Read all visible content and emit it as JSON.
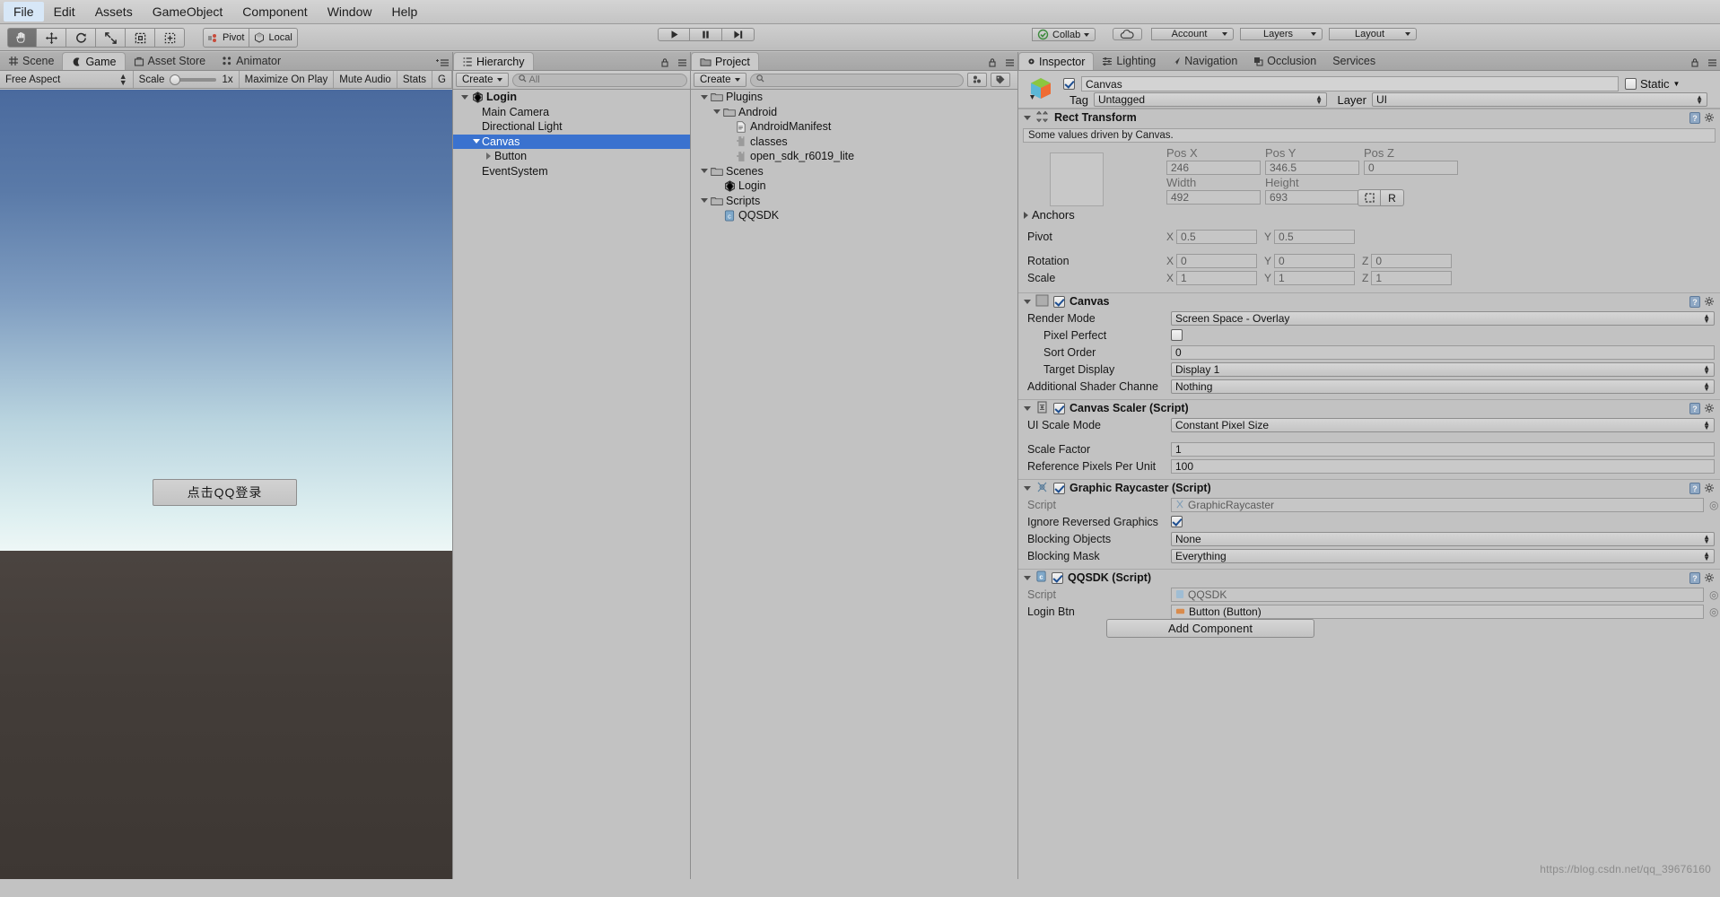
{
  "menubar": {
    "items": [
      "File",
      "Edit",
      "Assets",
      "GameObject",
      "Component",
      "Window",
      "Help"
    ]
  },
  "toolbar": {
    "tools": [
      {
        "name": "hand-tool",
        "selected": true
      },
      {
        "name": "move-tool",
        "selected": false
      },
      {
        "name": "rotate-tool",
        "selected": false
      },
      {
        "name": "scale-tool",
        "selected": false
      },
      {
        "name": "rect-tool",
        "selected": false
      },
      {
        "name": "transform-tool",
        "selected": false
      }
    ],
    "pivot_label": "Pivot",
    "local_label": "Local",
    "play_label": "▶",
    "pause_label": "❙❙",
    "step_label": "▶❙",
    "collab_label": "Collab",
    "cloud_label": "cloud-icon",
    "account_label": "Account",
    "layers_label": "Layers",
    "layout_label": "Layout"
  },
  "sceneview": {
    "tabs": [
      {
        "label": "Scene",
        "icon": "grid-icon",
        "active": false
      },
      {
        "label": "Game",
        "icon": "gamepad-icon",
        "active": true
      },
      {
        "label": "Asset Store",
        "icon": "store-icon",
        "active": false
      },
      {
        "label": "Animator",
        "icon": "animator-icon",
        "active": false
      }
    ],
    "gamebar": {
      "aspect": "Free Aspect",
      "scale_label": "Scale",
      "scale_value": "1x",
      "maximize_label": "Maximize On Play",
      "mute_label": "Mute Audio",
      "stats_label": "Stats",
      "gizmos_label": "G"
    },
    "button_label": "点击QQ登录"
  },
  "hierarchy": {
    "tab_label": "Hierarchy",
    "create_label": "Create",
    "search_placeholder": "All",
    "items": [
      {
        "label": "Login",
        "depth": 0,
        "icon": "unity-scene-icon",
        "arrow": "down",
        "bold": true,
        "selected": false
      },
      {
        "label": "Main Camera",
        "depth": 1,
        "icon": "none",
        "arrow": "none",
        "bold": false,
        "selected": false
      },
      {
        "label": "Directional Light",
        "depth": 1,
        "icon": "none",
        "arrow": "none",
        "bold": false,
        "selected": false
      },
      {
        "label": "Canvas",
        "depth": 1,
        "icon": "none",
        "arrow": "down",
        "bold": false,
        "selected": true
      },
      {
        "label": "Button",
        "depth": 2,
        "icon": "none",
        "arrow": "right",
        "bold": false,
        "selected": false
      },
      {
        "label": "EventSystem",
        "depth": 1,
        "icon": "none",
        "arrow": "none",
        "bold": false,
        "selected": false
      }
    ]
  },
  "project": {
    "tab_label": "Project",
    "create_label": "Create",
    "search_placeholder": "",
    "items": [
      {
        "label": "Plugins",
        "depth": 0,
        "icon": "folder-icon",
        "arrow": "down"
      },
      {
        "label": "Android",
        "depth": 1,
        "icon": "folder-icon",
        "arrow": "down"
      },
      {
        "label": "AndroidManifest",
        "depth": 2,
        "icon": "xml-file-icon",
        "arrow": "none"
      },
      {
        "label": "classes",
        "depth": 2,
        "icon": "plugin-icon",
        "arrow": "none"
      },
      {
        "label": "open_sdk_r6019_lite",
        "depth": 2,
        "icon": "plugin-icon",
        "arrow": "none"
      },
      {
        "label": "Scenes",
        "depth": 0,
        "icon": "folder-icon",
        "arrow": "down"
      },
      {
        "label": "Login",
        "depth": 1,
        "icon": "unity-scene-icon",
        "arrow": "none"
      },
      {
        "label": "Scripts",
        "depth": 0,
        "icon": "folder-icon",
        "arrow": "down"
      },
      {
        "label": "QQSDK",
        "depth": 1,
        "icon": "cs-script-icon",
        "arrow": "none"
      }
    ]
  },
  "inspector": {
    "tabs": [
      {
        "label": "Inspector",
        "icon": "inspector-icon",
        "active": true
      },
      {
        "label": "Lighting",
        "icon": "lighting-icon",
        "active": false
      },
      {
        "label": "Navigation",
        "icon": "navigation-icon",
        "active": false
      },
      {
        "label": "Occlusion",
        "icon": "occlusion-icon",
        "active": false
      },
      {
        "label": "Services",
        "icon": "services-icon",
        "active": false
      }
    ],
    "object_name": "Canvas",
    "object_enabled": true,
    "static_label": "Static",
    "static_checked": false,
    "tag_label": "Tag",
    "tag_value": "Untagged",
    "layer_label": "Layer",
    "layer_value": "UI",
    "rect_transform": {
      "title": "Rect Transform",
      "driven_note": "Some values driven by Canvas.",
      "pos_x_label": "Pos X",
      "pos_x": "246",
      "pos_y_label": "Pos Y",
      "pos_y": "346.5",
      "pos_z_label": "Pos Z",
      "pos_z": "0",
      "width_label": "Width",
      "width": "492",
      "height_label": "Height",
      "height": "693",
      "blueprint_label": "⬚",
      "raw_label": "R",
      "anchors_label": "Anchors",
      "pivot_label": "Pivot",
      "pivot_x": "0.5",
      "pivot_y": "0.5",
      "rotation_label": "Rotation",
      "rot_x": "0",
      "rot_y": "0",
      "rot_z": "0",
      "scale_label": "Scale",
      "scale_x": "1",
      "scale_y": "1",
      "scale_z": "1"
    },
    "canvas": {
      "title": "Canvas",
      "enabled": true,
      "render_mode_label": "Render Mode",
      "render_mode_value": "Screen Space - Overlay",
      "pixel_perfect_label": "Pixel Perfect",
      "pixel_perfect_checked": false,
      "sort_order_label": "Sort Order",
      "sort_order_value": "0",
      "target_display_label": "Target Display",
      "target_display_value": "Display 1",
      "shader_channel_label": "Additional Shader Channe",
      "shader_channel_value": "Nothing"
    },
    "canvas_scaler": {
      "title": "Canvas Scaler (Script)",
      "enabled": true,
      "ui_scale_mode_label": "UI Scale Mode",
      "ui_scale_mode_value": "Constant Pixel Size",
      "scale_factor_label": "Scale Factor",
      "scale_factor_value": "1",
      "ref_ppu_label": "Reference Pixels Per Unit",
      "ref_ppu_value": "100"
    },
    "graphic_raycaster": {
      "title": "Graphic Raycaster (Script)",
      "enabled": true,
      "script_label": "Script",
      "script_value": "GraphicRaycaster",
      "ignore_reversed_label": "Ignore Reversed Graphics",
      "ignore_reversed_checked": true,
      "blocking_objects_label": "Blocking Objects",
      "blocking_objects_value": "None",
      "blocking_mask_label": "Blocking Mask",
      "blocking_mask_value": "Everything"
    },
    "qqsdk": {
      "title": "QQSDK (Script)",
      "enabled": true,
      "script_label": "Script",
      "script_value": "QQSDK",
      "login_btn_label": "Login Btn",
      "login_btn_value": "Button (Button)"
    },
    "add_component_label": "Add Component"
  },
  "watermark": "https://blog.csdn.net/qq_39676160",
  "colors": {
    "selection_blue": "#3a72cf",
    "panel_gray": "#c2c2c2",
    "toolbar_gray": "#c6c6c6",
    "accent_checkbox": "#1d4e91"
  }
}
